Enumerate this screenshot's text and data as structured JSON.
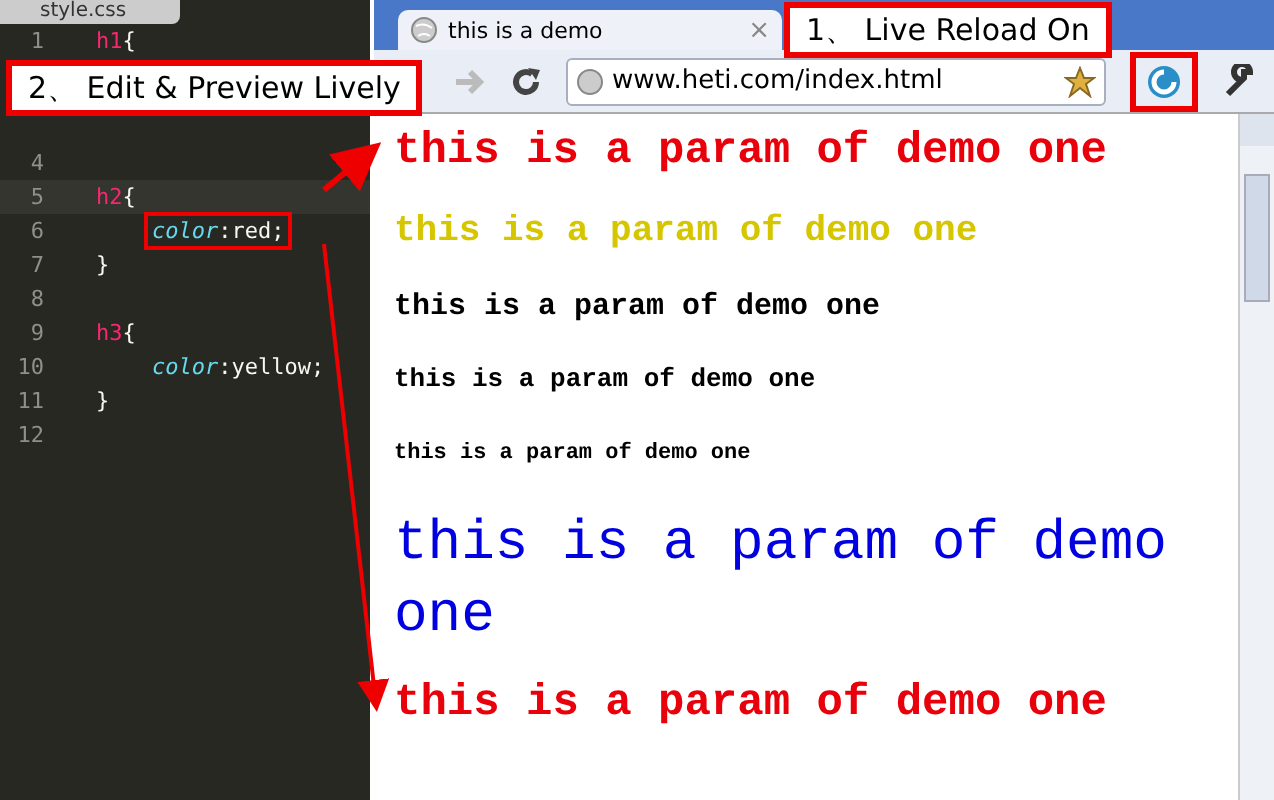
{
  "editor": {
    "tab": "style.css",
    "lines": [
      {
        "number": "1",
        "current": false,
        "boxed": false,
        "tokens": [
          {
            "kind": "selector",
            "text": "h1"
          },
          {
            "kind": "punct",
            "text": "{"
          }
        ]
      },
      {
        "number": "4",
        "current": false
      },
      {
        "number": "5",
        "current": true,
        "boxed": false,
        "tokens": [
          {
            "kind": "selector",
            "text": "h2"
          },
          {
            "kind": "punct",
            "text": "{"
          }
        ]
      },
      {
        "number": "6",
        "current": false,
        "boxed": true,
        "tokens": [
          {
            "kind": "property",
            "text": "color"
          },
          {
            "kind": "punct",
            "text": ":"
          },
          {
            "kind": "value",
            "text": "red;"
          }
        ]
      },
      {
        "number": "7",
        "current": false,
        "boxed": false,
        "tokens": [
          {
            "kind": "punct",
            "text": "}"
          }
        ]
      },
      {
        "number": "8",
        "current": false
      },
      {
        "number": "9",
        "current": false,
        "boxed": false,
        "tokens": [
          {
            "kind": "selector",
            "text": "h3"
          },
          {
            "kind": "punct",
            "text": "{"
          }
        ]
      },
      {
        "number": "10",
        "current": false,
        "boxed": false,
        "tokens": [
          {
            "kind": "property",
            "text": "color"
          },
          {
            "kind": "punct",
            "text": ":"
          },
          {
            "kind": "value",
            "text": "yellow;"
          }
        ]
      },
      {
        "number": "11",
        "current": false,
        "boxed": false,
        "tokens": [
          {
            "kind": "punct",
            "text": "}"
          }
        ]
      },
      {
        "number": "12",
        "current": false
      }
    ]
  },
  "browser": {
    "tab_title": "this is a demo",
    "tab_close": "×",
    "url": "www.heti.com/index.html",
    "paragraphs": [
      {
        "kind": "h1",
        "text": "this is a param of demo one",
        "color": "#e8000b"
      },
      {
        "kind": "h2",
        "text": "this is a param of demo one",
        "color": "#d6c600"
      },
      {
        "kind": "h3",
        "text": "this is a param of demo one",
        "color": "#000000"
      },
      {
        "kind": "h4",
        "text": "this is a param of demo one",
        "color": "#000000"
      },
      {
        "kind": "h5",
        "text": "this is a param of demo one",
        "color": "#000000"
      },
      {
        "kind": "big",
        "text": "this is a param of demo one",
        "color": "#0000e0"
      },
      {
        "kind": "h1",
        "text": "this is a param of demo one",
        "color": "#e8000b"
      }
    ]
  },
  "callouts": [
    {
      "kind": "reload",
      "text": "1、 Live Reload On"
    },
    {
      "kind": "edit",
      "text": "2、 Edit & Preview Lively"
    }
  ]
}
